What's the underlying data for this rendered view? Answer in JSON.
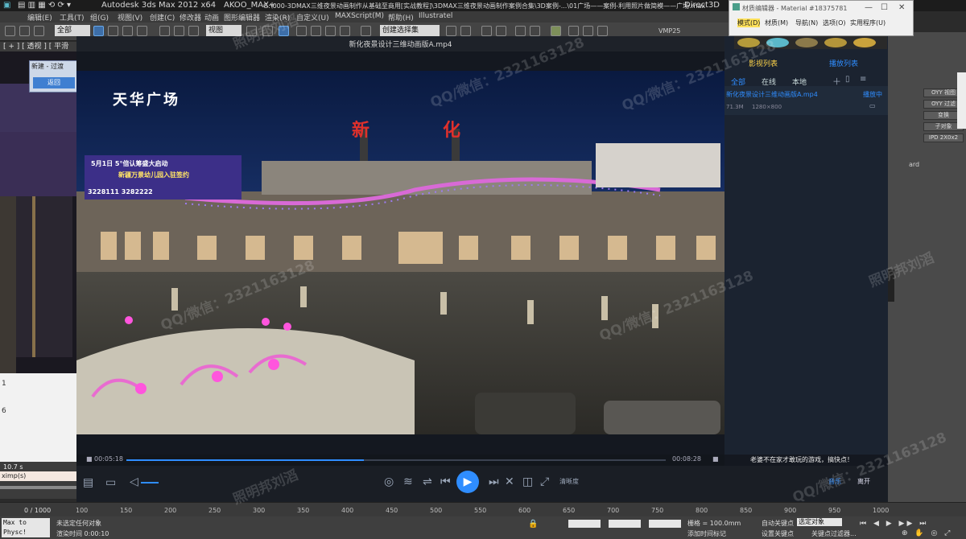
{
  "max_title": {
    "app": "Autodesk 3ds Max  2012 x64",
    "plugin": "AKOO_MAX+",
    "path": "G:\\000-3DMAX三维夜景动画制作从基础至商用[实战教程]\\3DMAX三维夜景动画制作案例合集\\3D案例-...\\01广场——案例-利用照片做简模——广场.max",
    "renderer": "Direct3D"
  },
  "max_menu": [
    "编辑(E)",
    "工具(T)",
    "组(G)",
    "视图(V)",
    "创建(C)",
    "修改器",
    "动画",
    "图形编辑器",
    "渲染(R)",
    "自定义(U)",
    "MAXScript(M)",
    "帮助(H)",
    "Illustratel"
  ],
  "max_toolbar": {
    "selection_filter": "全部",
    "ref_coord": "视图",
    "named_selection": "创建选择集",
    "render_label": "VMP25"
  },
  "viewport": {
    "label": "[ + ] [ 透视 ] [ 平滑 + 高光 ]"
  },
  "left_sub_window": {
    "title": "新建 - 过渡",
    "button": "返回"
  },
  "left_white": {
    "lines": [
      "1",
      "6"
    ]
  },
  "left_bottom": {
    "value1": "10.7 s",
    "value2": "ximp(s)"
  },
  "timeline": {
    "frame_counter": "0 / 1000",
    "ticks": [
      "100",
      "150",
      "200",
      "250",
      "300",
      "350",
      "400",
      "450",
      "500",
      "550",
      "600",
      "650",
      "700",
      "750",
      "800",
      "850",
      "900",
      "950",
      "1000"
    ]
  },
  "status_bar": {
    "script_label": "Max to Physc!",
    "selection": "未选定任何对象",
    "render_time": "渲染时间  0:00:10",
    "grid": "栅格 = 100.0mm",
    "auto_key": "自动关键点",
    "set_key": "设置关键点",
    "key_filters": "关键点过滤器...",
    "selected": "选定对象",
    "add_time_tag": "添加时间标记"
  },
  "material_editor": {
    "title": "材质编辑器 - Material #18375781",
    "menu": [
      "模式(D)",
      "材质(M)",
      "导航(N)",
      "选项(O)",
      "实用程序(U)"
    ]
  },
  "cmd_panel": {
    "buttons": [
      "OYY 视图",
      "OYY 过滤",
      "变换",
      "子对象",
      "IPD 2X0x2"
    ],
    "label": "ard"
  },
  "player": {
    "title": "新化夜景设计三维动画版A.mp4",
    "video_sign_1": "天华广场",
    "video_sign_2_a": "新",
    "video_sign_2_b": "化",
    "video_banner_1": "5月1日 5°倍认筹盛大启动",
    "video_banner_2": "新疆万景幼儿园入驻签约",
    "video_banner_3": "3228111  3282222",
    "time_current": "00:05:18",
    "time_total": "00:08:28",
    "progress": 0.44,
    "ticker": "老婆不在家才敢玩的游戏，搞快点！",
    "quality_label": "清晰度",
    "bottom_right_1": "音乐",
    "bottom_right_2": "离开"
  },
  "playlist": {
    "header_left": "影视列表",
    "header_right": "播放列表",
    "tabs": [
      "全部",
      "在线",
      "本地"
    ],
    "item_title": "新化夜景设计三维动画版A.mp4",
    "item_status": "播放中",
    "item_size": "71.3M",
    "item_resolution": "1280×800"
  },
  "watermarks": [
    "QQ/微信：2321163128",
    "照明邦刘滔"
  ],
  "colors": {
    "accent": "#2f8dff",
    "sign_red": "#e0302b",
    "neon_pink": "#e86cd0"
  }
}
